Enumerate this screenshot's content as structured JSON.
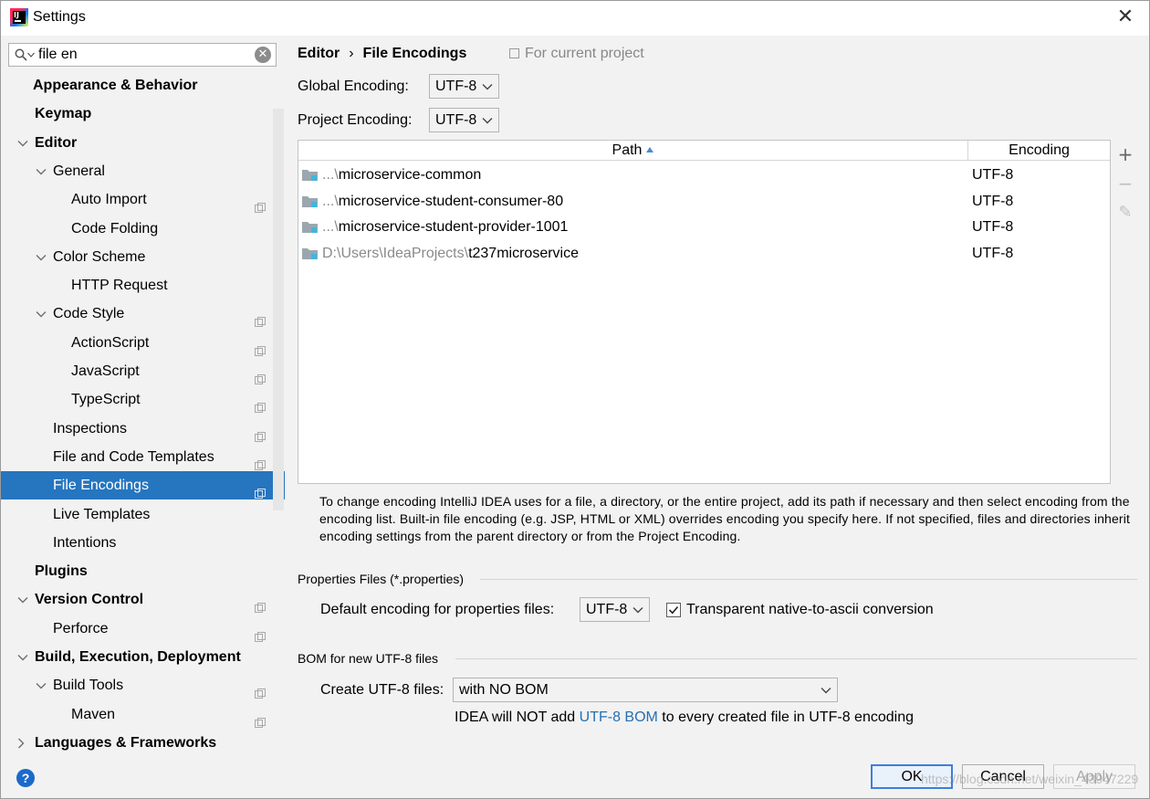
{
  "window": {
    "title": "Settings"
  },
  "search": {
    "value": "file en"
  },
  "sidebar": {
    "items": [
      {
        "label": "Appearance & Behavior",
        "level": 0,
        "bold": true,
        "expander": "none",
        "proj": false
      },
      {
        "label": "Keymap",
        "level": 0,
        "bold": true,
        "expander": "none",
        "proj": false
      },
      {
        "label": "Editor",
        "level": 0,
        "bold": true,
        "expander": "open",
        "proj": false
      },
      {
        "label": "General",
        "level": 1,
        "bold": false,
        "expander": "open",
        "proj": false
      },
      {
        "label": "Auto Import",
        "level": 2,
        "bold": false,
        "expander": "none",
        "proj": true
      },
      {
        "label": "Code Folding",
        "level": 2,
        "bold": false,
        "expander": "none",
        "proj": false
      },
      {
        "label": "Color Scheme",
        "level": 1,
        "bold": false,
        "expander": "open",
        "proj": false
      },
      {
        "label": "HTTP Request",
        "level": 2,
        "bold": false,
        "expander": "none",
        "proj": false
      },
      {
        "label": "Code Style",
        "level": 1,
        "bold": false,
        "expander": "open",
        "proj": true
      },
      {
        "label": "ActionScript",
        "level": 2,
        "bold": false,
        "expander": "none",
        "proj": true
      },
      {
        "label": "JavaScript",
        "level": 2,
        "bold": false,
        "expander": "none",
        "proj": true
      },
      {
        "label": "TypeScript",
        "level": 2,
        "bold": false,
        "expander": "none",
        "proj": true
      },
      {
        "label": "Inspections",
        "level": 1,
        "bold": false,
        "expander": "none",
        "proj": true
      },
      {
        "label": "File and Code Templates",
        "level": 1,
        "bold": false,
        "expander": "none",
        "proj": true
      },
      {
        "label": "File Encodings",
        "level": 1,
        "bold": false,
        "expander": "none",
        "proj": true,
        "selected": true
      },
      {
        "label": "Live Templates",
        "level": 1,
        "bold": false,
        "expander": "none",
        "proj": false
      },
      {
        "label": "Intentions",
        "level": 1,
        "bold": false,
        "expander": "none",
        "proj": false
      },
      {
        "label": "Plugins",
        "level": 0,
        "bold": true,
        "expander": "none",
        "proj": false
      },
      {
        "label": "Version Control",
        "level": 0,
        "bold": true,
        "expander": "open",
        "proj": true
      },
      {
        "label": "Perforce",
        "level": 1,
        "bold": false,
        "expander": "none",
        "proj": true
      },
      {
        "label": "Build, Execution, Deployment",
        "level": 0,
        "bold": true,
        "expander": "open",
        "proj": false
      },
      {
        "label": "Build Tools",
        "level": 1,
        "bold": false,
        "expander": "open",
        "proj": true
      },
      {
        "label": "Maven",
        "level": 2,
        "bold": false,
        "expander": "none",
        "proj": true
      },
      {
        "label": "Languages & Frameworks",
        "level": 0,
        "bold": true,
        "expander": "closed",
        "proj": false
      }
    ]
  },
  "breadcrumb": {
    "parent": "Editor",
    "separator": "›",
    "current": "File Encodings"
  },
  "for_project": "For current project",
  "global_encoding": {
    "label": "Global Encoding:",
    "value": "UTF-8"
  },
  "project_encoding": {
    "label": "Project Encoding:",
    "value": "UTF-8"
  },
  "table": {
    "col_path": "Path",
    "col_encoding": "Encoding",
    "rows": [
      {
        "prefix": "...\\",
        "name": "microservice-common",
        "encoding": "UTF-8"
      },
      {
        "prefix": "...\\",
        "name": "microservice-student-consumer-80",
        "encoding": "UTF-8"
      },
      {
        "prefix": "...\\",
        "name": "microservice-student-provider-1001",
        "encoding": "UTF-8"
      },
      {
        "prefix": "D:\\Users\\IdeaProjects\\",
        "name": "t237microservice",
        "encoding": "UTF-8"
      }
    ]
  },
  "tools": {
    "add": "+",
    "remove": "−",
    "edit": "✎"
  },
  "info": "To change encoding IntelliJ IDEA uses for a file, a directory, or the entire project, add its path if necessary and then select encoding from the encoding list. Built-in file encoding (e.g. JSP, HTML or XML) overrides encoding you specify here. If not specified, files and directories inherit encoding settings from the parent directory or from the Project Encoding.",
  "properties": {
    "title": "Properties Files (*.properties)",
    "label": "Default encoding for properties files:",
    "value": "UTF-8",
    "checkbox_label": "Transparent native-to-ascii conversion",
    "checked": true
  },
  "bom": {
    "title": "BOM for new UTF-8 files",
    "label": "Create UTF-8 files:",
    "value": "with NO BOM",
    "note_before": "IDEA will NOT add ",
    "note_link": "UTF-8 BOM",
    "note_after": " to every created file in UTF-8 encoding"
  },
  "footer": {
    "help": "?",
    "ok": "OK",
    "cancel": "Cancel",
    "apply": "Apply",
    "watermark": "https://blog.csdn.net/weixin_43947229"
  },
  "colors": {
    "selection": "#2675bf",
    "link": "#2470b3",
    "panel": "#f2f2f2"
  }
}
